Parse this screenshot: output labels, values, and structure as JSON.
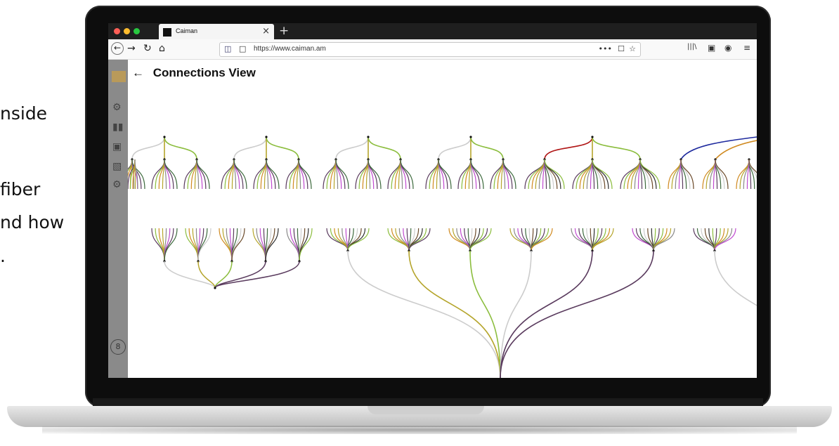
{
  "side_text": [
    "nside",
    "fiber",
    "nd how",
    "."
  ],
  "browser": {
    "tab_title": "Caiman",
    "tab_close": "×",
    "new_tab": "+",
    "url": "https://www.caiman.am",
    "nav": {
      "back": "←",
      "forward": "→",
      "reload": "↻",
      "home": "⌂"
    },
    "url_actions": [
      "•••",
      "☐",
      "☆"
    ],
    "toolbar_right": [
      "|||\\",
      "▣",
      "◉",
      "≡"
    ]
  },
  "app": {
    "page_title": "Connections View",
    "back_arrow": "←",
    "avatar_glyph": "8"
  },
  "colors": {
    "fiber_white": "#cccccc",
    "fiber_green": "#8bbd3d",
    "fiber_olive": "#b5a52c",
    "fiber_red": "#b01515",
    "fiber_blue": "#1e2a9e",
    "fiber_orange": "#d08a20",
    "fiber_purple": "#5a3b5e"
  },
  "icons": [
    "shield-icon",
    "lock-icon",
    "menu-icon",
    "bookmark-icon",
    "star-icon",
    "library-icon",
    "sidebar-icon",
    "account-icon"
  ]
}
